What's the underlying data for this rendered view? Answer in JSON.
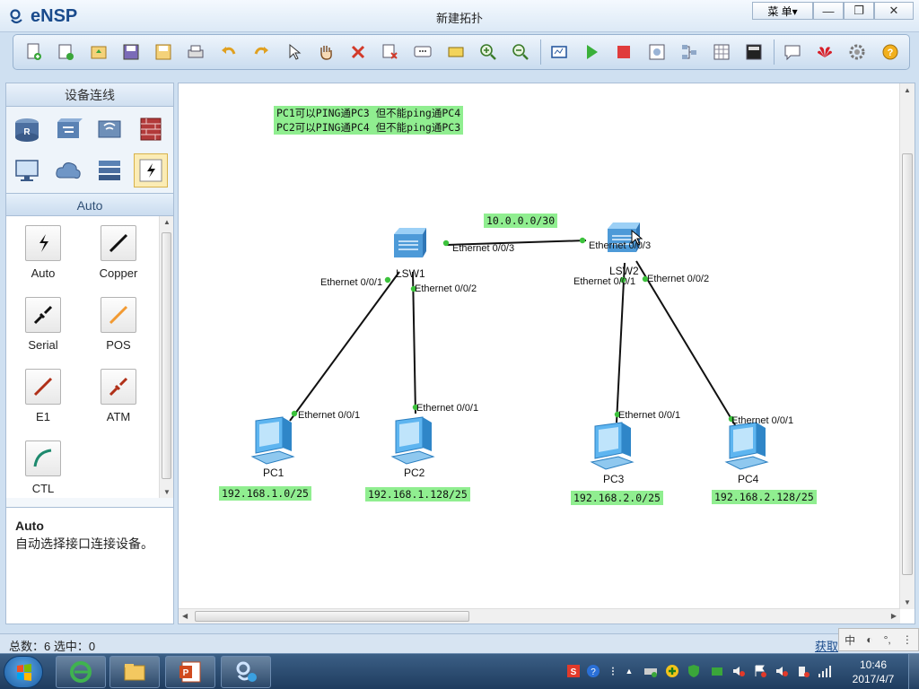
{
  "app": {
    "logo_text": "eNSP",
    "window_title": "新建拓扑",
    "menu_label": "菜 单▾",
    "window_controls": {
      "minimize": "—",
      "restore": "❐",
      "close": "✕"
    }
  },
  "toolbar": {
    "buttons": [
      "new-topology",
      "new-lab",
      "open",
      "save",
      "save-as",
      "print",
      "undo",
      "redo",
      "select",
      "pan",
      "delete",
      "delete-all-links",
      "add-text",
      "add-shape",
      "zoom-in",
      "zoom-out",
      "fit-view",
      "start-device",
      "stop-device",
      "capture-data",
      "topology-grid",
      "palette",
      "cli-console",
      "chat",
      "huawei",
      "settings",
      "help"
    ]
  },
  "left_panel": {
    "device_header": "设备连线",
    "devices": [
      "router-icon",
      "switch-icon",
      "wlan-icon",
      "firewall-icon",
      "pc-icon",
      "cloud-icon",
      "other-device-icon",
      "connection-icon"
    ],
    "cable_header": "Auto",
    "cables": [
      {
        "label": "Auto",
        "color": "#111111"
      },
      {
        "label": "Copper",
        "color": "#111111"
      },
      {
        "label": "Serial",
        "color": "#111111"
      },
      {
        "label": "POS",
        "color": "#f29a32"
      },
      {
        "label": "E1",
        "color": "#b03018"
      },
      {
        "label": "ATM",
        "color": "#b03018"
      },
      {
        "label": "CTL",
        "color": "#1e8a6e"
      }
    ],
    "description": {
      "title": "Auto",
      "text": "自动选择接口连接设备。"
    }
  },
  "topology": {
    "notes": {
      "line1": "PC1可以PING通PC3 但不能ping通PC4",
      "line2": "PC2可以PING通PC4 但不能ping通PC3",
      "trunk_net": "10.0.0.0/30"
    },
    "devices": {
      "lsw1": "LSW1",
      "lsw2": "LSW2",
      "pc1": "PC1",
      "pc2": "PC2",
      "pc3": "PC3",
      "pc4": "PC4"
    },
    "subnets": {
      "pc1": "192.168.1.0/25",
      "pc2": "192.168.1.128/25",
      "pc3": "192.168.2.0/25",
      "pc4": "192.168.2.128/25"
    },
    "interfaces": {
      "lsw1_e3": "Ethernet 0/0/3",
      "lsw1_e1": "Ethernet 0/0/1",
      "lsw1_e2": "Ethernet 0/0/2",
      "lsw2_e3": "Ethernet 0/0/3",
      "lsw2_e1": "Ethernet 0/0/1",
      "lsw2_e2": "Ethernet 0/0/2",
      "pc1_e1": "Ethernet 0/0/1",
      "pc2_e1": "Ethernet 0/0/1",
      "pc3_e1": "Ethernet 0/0/1",
      "pc4_e1": "Ethernet 0/0/1"
    },
    "link_color": "#111111",
    "port_dot_color": "#3cc23c",
    "label_bg": "#90ee90"
  },
  "status": {
    "left": "总数：6  选中：0",
    "right": "获取"
  },
  "ime": {
    "label": "中"
  },
  "taskbar": {
    "time": "10:46",
    "date": "2017/4/7",
    "apps": [
      "ie-icon",
      "explorer-icon",
      "powerpoint-icon",
      "ensp-icon"
    ]
  }
}
